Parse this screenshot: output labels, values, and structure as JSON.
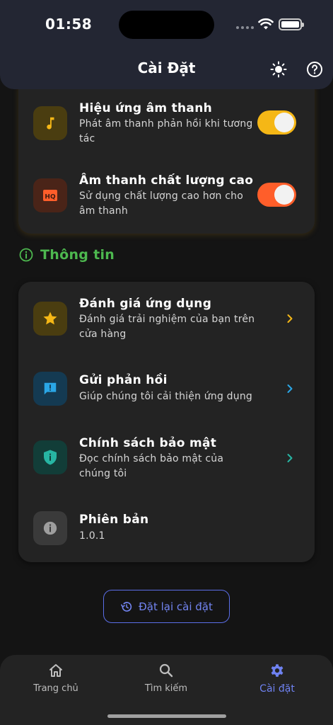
{
  "status_bar": {
    "time": "01:58"
  },
  "header": {
    "title": "Cài Đặt",
    "sun_icon": "sun-icon",
    "help_icon": "help-circle-icon"
  },
  "audio_settings": {
    "items": [
      {
        "title": "Hiệu ứng âm thanh",
        "subtitle": "Phát âm thanh phản hồi khi tương tác",
        "icon": "music-note-icon",
        "toggle_on": true,
        "color": "#f5b716"
      },
      {
        "title": "Âm thanh chất lượng cao",
        "subtitle": "Sử dụng chất lượng cao hơn cho âm thanh",
        "icon": "hq-icon",
        "toggle_on": true,
        "color": "#ff5e2a"
      }
    ]
  },
  "info_section": {
    "title": "Thông tin",
    "icon": "info-circle-icon",
    "color": "#4db84f",
    "items": [
      {
        "title": "Đánh giá ứng dụng",
        "subtitle": "Đánh giá trải nghiệm của bạn trên cửa hàng",
        "icon": "star-icon",
        "color": "#f5b716"
      },
      {
        "title": "Gửi phản hồi",
        "subtitle": "Giúp chúng tôi cải thiện ứng dụng",
        "icon": "feedback-icon",
        "color": "#2aa6e6"
      },
      {
        "title": "Chính sách bảo mật",
        "subtitle": "Đọc chính sách bảo mật của chúng tôi",
        "icon": "shield-icon",
        "color": "#27b5a3"
      },
      {
        "title": "Phiên bản",
        "subtitle": "1.0.1",
        "icon": "info-icon",
        "color": "#9e9e9e"
      }
    ]
  },
  "reset_button": {
    "label": "Đặt lại cài đặt",
    "icon": "history-icon",
    "color": "#5b6ee8"
  },
  "bottom_nav": {
    "items": [
      {
        "label": "Trang chủ",
        "icon": "home-icon",
        "active": false
      },
      {
        "label": "Tìm kiếm",
        "icon": "search-icon",
        "active": false
      },
      {
        "label": "Cài đặt",
        "icon": "gear-icon",
        "active": true
      }
    ],
    "active_color": "#6f82f1"
  }
}
